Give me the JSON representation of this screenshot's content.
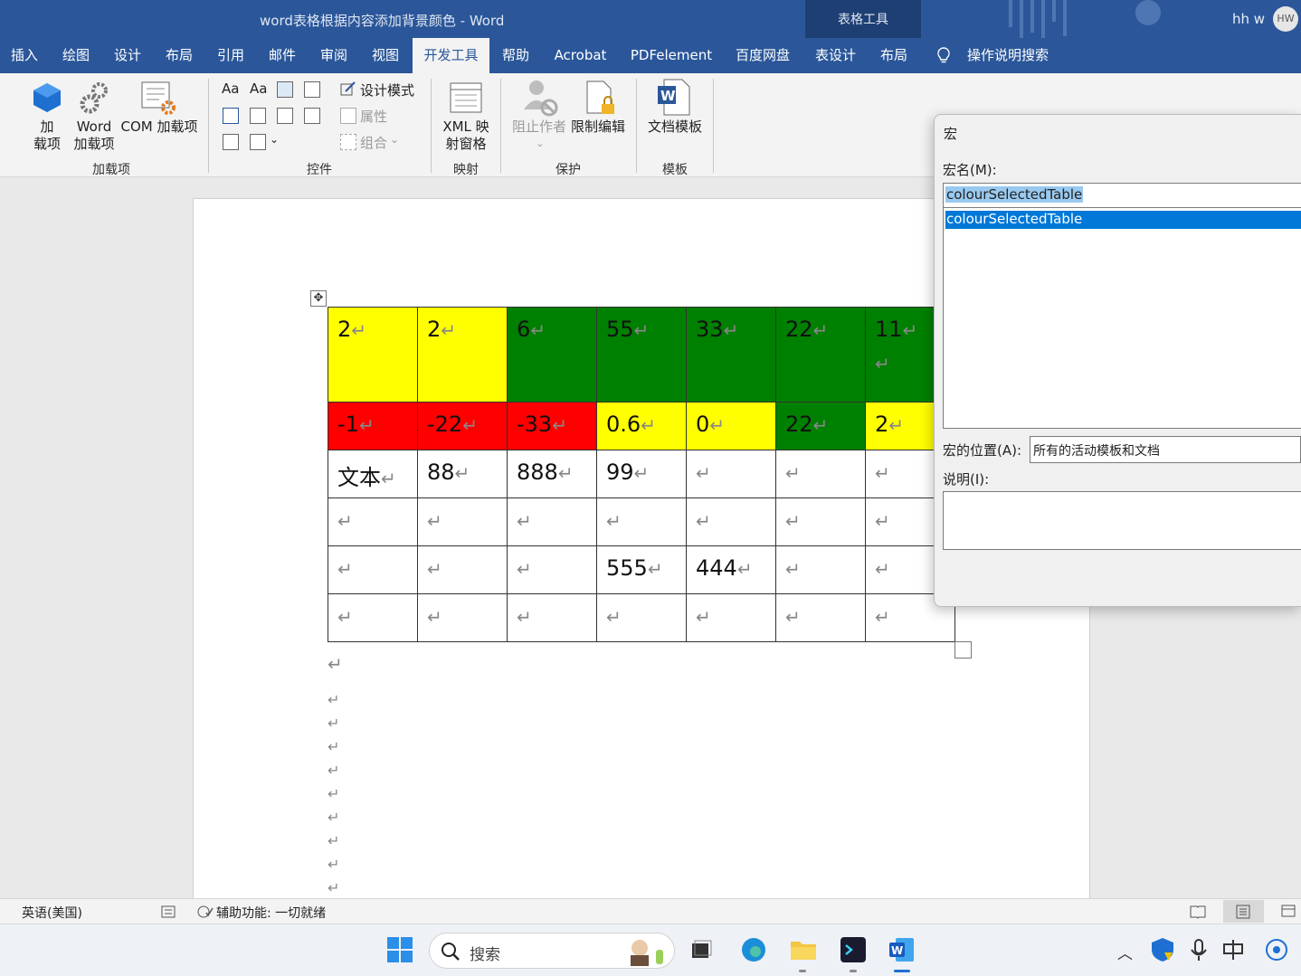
{
  "window": {
    "title": "word表格根据内容添加背景颜色  -  Word",
    "contextual_group": "表格工具",
    "user_name": "hh w",
    "user_initials": "HW"
  },
  "ribbon_tabs": [
    {
      "label": "插入",
      "active": false
    },
    {
      "label": "绘图",
      "active": false
    },
    {
      "label": "设计",
      "active": false
    },
    {
      "label": "布局",
      "active": false
    },
    {
      "label": "引用",
      "active": false
    },
    {
      "label": "邮件",
      "active": false
    },
    {
      "label": "审阅",
      "active": false
    },
    {
      "label": "视图",
      "active": false
    },
    {
      "label": "开发工具",
      "active": true
    },
    {
      "label": "帮助",
      "active": false
    },
    {
      "label": "Acrobat",
      "active": false
    },
    {
      "label": "PDFelement",
      "active": false
    },
    {
      "label": "百度网盘",
      "active": false
    },
    {
      "label": "表设计",
      "active": false
    },
    {
      "label": "布局",
      "active": false
    }
  ],
  "tell_me": "操作说明搜索",
  "ribbon": {
    "addins": {
      "group_label": "加载项",
      "addins_btn_line1": "加",
      "addins_btn_line2": "载项",
      "word_addins_line1": "Word",
      "word_addins_line2": "加载项",
      "com_addins": "COM 加载项"
    },
    "controls": {
      "group_label": "控件",
      "design_mode": "设计模式",
      "properties": "属性",
      "group": "组合"
    },
    "mapping": {
      "group_label": "映射",
      "xml_line1": "XML 映",
      "xml_line2": "射窗格"
    },
    "protect": {
      "group_label": "保护",
      "block_authors": "阻止作者",
      "restrict_editing": "限制编辑"
    },
    "templates": {
      "group_label": "模板",
      "doc_template": "文档模板"
    }
  },
  "colors": {
    "yellow": "#ffff00",
    "green": "#008000",
    "red": "#ff0000",
    "white": "#ffffff",
    "word_blue": "#2b579a"
  },
  "table": {
    "rows": [
      [
        {
          "text": "2",
          "bg": "yellow"
        },
        {
          "text": "2",
          "bg": "yellow"
        },
        {
          "text": "6",
          "bg": "green"
        },
        {
          "text": "55",
          "bg": "green"
        },
        {
          "text": "33",
          "bg": "green"
        },
        {
          "text": "22",
          "bg": "green"
        },
        {
          "text": "11",
          "bg": "green"
        }
      ],
      [
        {
          "text": "-1",
          "bg": "red"
        },
        {
          "text": "-22",
          "bg": "red"
        },
        {
          "text": "-33",
          "bg": "red"
        },
        {
          "text": "0.6",
          "bg": "yellow"
        },
        {
          "text": "0",
          "bg": "yellow"
        },
        {
          "text": "22",
          "bg": "green"
        },
        {
          "text": "2",
          "bg": "yellow"
        }
      ],
      [
        {
          "text": "文本",
          "bg": "white"
        },
        {
          "text": "88",
          "bg": "white"
        },
        {
          "text": "888",
          "bg": "white"
        },
        {
          "text": "99",
          "bg": "white"
        },
        {
          "text": "",
          "bg": "white"
        },
        {
          "text": "",
          "bg": "white"
        },
        {
          "text": "",
          "bg": "white"
        }
      ],
      [
        {
          "text": "",
          "bg": "white"
        },
        {
          "text": "",
          "bg": "white"
        },
        {
          "text": "",
          "bg": "white"
        },
        {
          "text": "",
          "bg": "white"
        },
        {
          "text": "",
          "bg": "white"
        },
        {
          "text": "",
          "bg": "white"
        },
        {
          "text": "",
          "bg": "white"
        }
      ],
      [
        {
          "text": "",
          "bg": "white"
        },
        {
          "text": "",
          "bg": "white"
        },
        {
          "text": "",
          "bg": "white"
        },
        {
          "text": "555",
          "bg": "white"
        },
        {
          "text": "444",
          "bg": "white"
        },
        {
          "text": "",
          "bg": "white"
        },
        {
          "text": "",
          "bg": "white"
        }
      ],
      [
        {
          "text": "",
          "bg": "white"
        },
        {
          "text": "",
          "bg": "white"
        },
        {
          "text": "",
          "bg": "white"
        },
        {
          "text": "",
          "bg": "white"
        },
        {
          "text": "",
          "bg": "white"
        },
        {
          "text": "",
          "bg": "white"
        },
        {
          "text": "",
          "bg": "white"
        }
      ]
    ],
    "paragraph_mark": "↵"
  },
  "macro_dialog": {
    "title": "宏",
    "name_label": "宏名(M):",
    "name_value": "colourSelectedTable",
    "list_items": [
      "colourSelectedTable"
    ],
    "location_label": "宏的位置(A):",
    "location_value": "所有的活动模板和文档",
    "description_label": "说明(I):"
  },
  "statusbar": {
    "language": "英语(美国)",
    "accessibility": "辅助功能: 一切就绪"
  },
  "taskbar": {
    "search_placeholder": "搜索"
  }
}
